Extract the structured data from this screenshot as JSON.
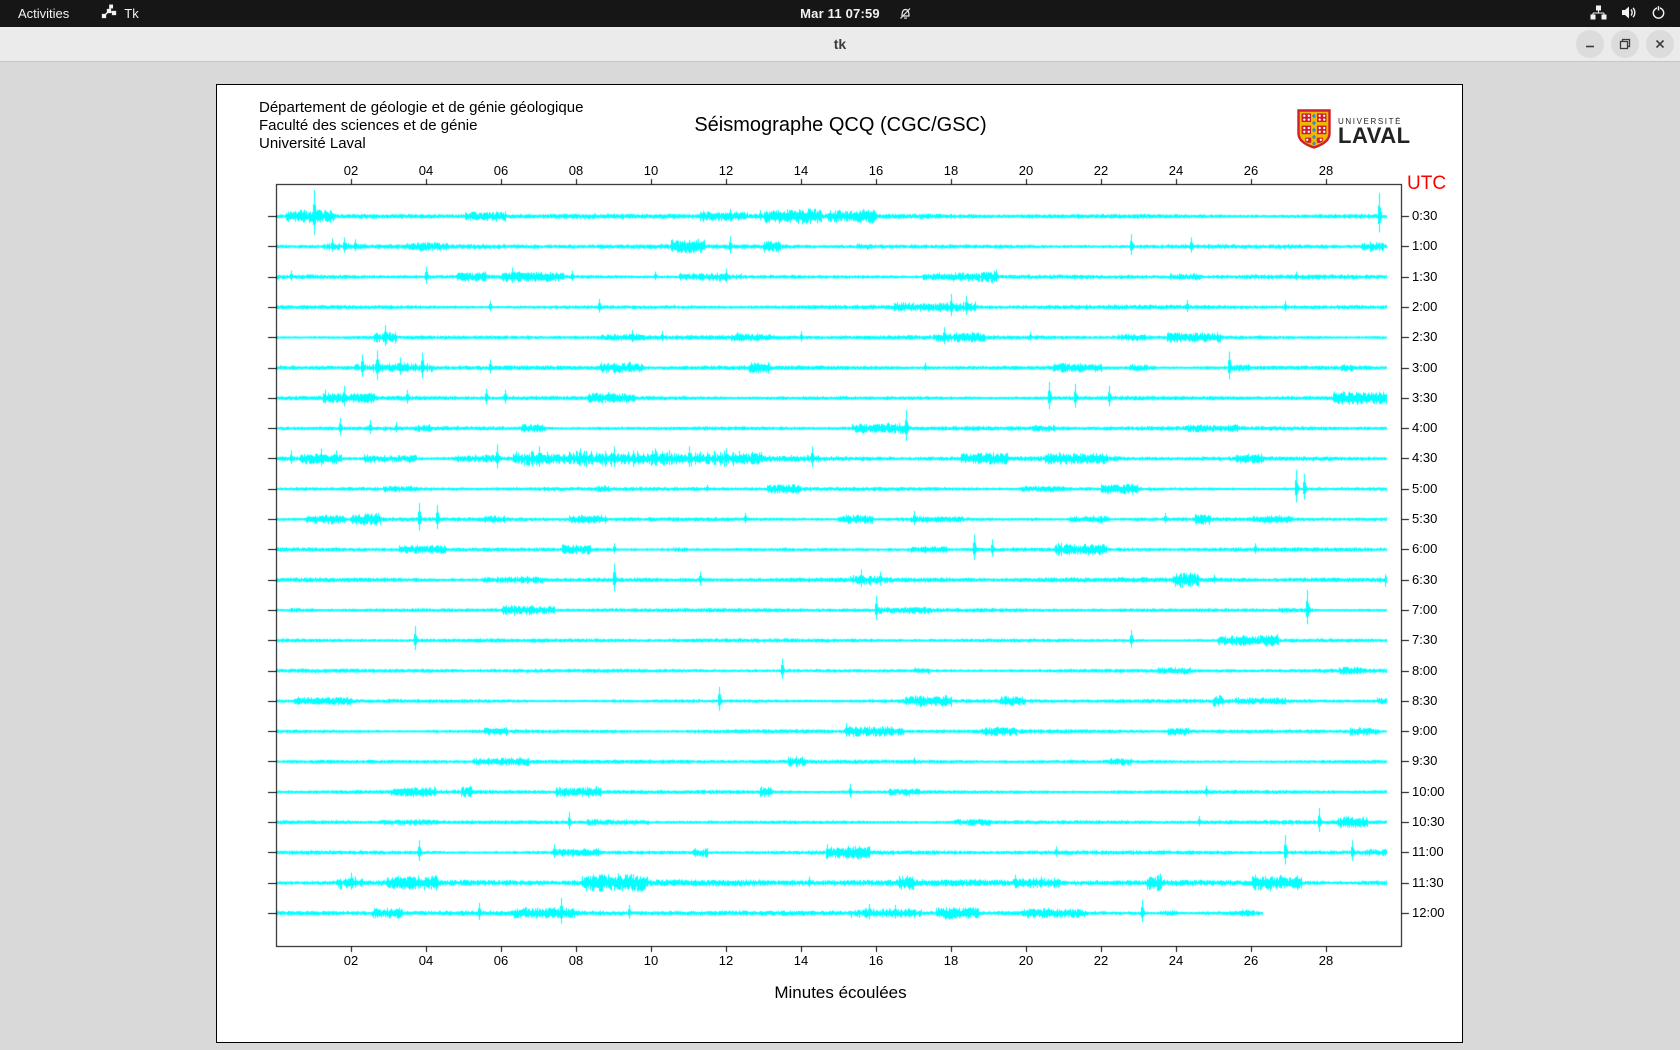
{
  "top_bar": {
    "activities_label": "Activities",
    "app_name": "Tk",
    "clock": "Mar 11 07:59",
    "icons": [
      "tk-app-icon",
      "notifications-disabled-icon",
      "network-wired-icon",
      "volume-icon",
      "power-icon"
    ]
  },
  "title_bar": {
    "title": "tk",
    "buttons": [
      "minimize",
      "restore",
      "close"
    ]
  },
  "figure": {
    "header_lines": [
      "Département de géologie et de génie géologique",
      "Faculté des sciences et de génie",
      "Université Laval"
    ],
    "title": "Séismographe QCQ (CGC/GSC)",
    "logo": {
      "line1": "UNIVERSITÉ",
      "line2": "LAVAL"
    },
    "utc_label": "UTC",
    "xlabel": "Minutes écoulées"
  },
  "colors": {
    "trace": "#00ffff",
    "axis": "#000000",
    "utc_label": "#ff0000",
    "logo_red": "#cf1f2f",
    "logo_gold": "#f2b705",
    "logo_blue": "#2b8fd0"
  },
  "chart_data": {
    "type": "line",
    "subtype": "helicorder-seismogram",
    "title": "Séismographe QCQ (CGC/GSC)",
    "xlabel": "Minutes écoulées",
    "x_range_minutes": [
      0,
      30
    ],
    "x_ticks": [
      "02",
      "04",
      "06",
      "08",
      "10",
      "12",
      "14",
      "16",
      "18",
      "20",
      "22",
      "24",
      "26",
      "28"
    ],
    "y_axis_side": "right",
    "y_unit": "UTC",
    "grid": false,
    "rows": [
      {
        "label": "0:30",
        "noise": 1.3,
        "end": 29.6,
        "spikes": [
          [
            1.0,
            26
          ],
          [
            12.1,
            7
          ],
          [
            12.9,
            6
          ],
          [
            29.4,
            23
          ]
        ],
        "bursts": [
          [
            11.5,
            13.5,
            3
          ]
        ]
      },
      {
        "label": "1:00",
        "noise": 1.2,
        "end": 29.6,
        "spikes": [
          [
            1.5,
            8
          ],
          [
            1.8,
            9
          ],
          [
            2.1,
            7
          ],
          [
            12.1,
            10
          ],
          [
            22.8,
            12
          ],
          [
            24.4,
            9
          ]
        ],
        "bursts": [
          [
            1.2,
            2.4,
            4
          ]
        ]
      },
      {
        "label": "1:30",
        "noise": 1.1,
        "end": 29.6,
        "spikes": [
          [
            0.4,
            6
          ],
          [
            4.0,
            10
          ],
          [
            6.3,
            9
          ],
          [
            7.9,
            6
          ],
          [
            10.1,
            5
          ],
          [
            12.0,
            8
          ],
          [
            19.2,
            7
          ],
          [
            27.2,
            5
          ]
        ],
        "bursts": [
          [
            11.7,
            12.4,
            4
          ]
        ]
      },
      {
        "label": "2:00",
        "noise": 1.1,
        "end": 29.6,
        "spikes": [
          [
            5.7,
            6
          ],
          [
            8.6,
            8
          ],
          [
            18.0,
            13
          ],
          [
            18.4,
            11
          ],
          [
            24.3,
            7
          ],
          [
            26.9,
            6
          ]
        ],
        "bursts": [
          [
            17.7,
            18.7,
            5
          ]
        ]
      },
      {
        "label": "2:30",
        "noise": 1.1,
        "end": 29.6,
        "spikes": [
          [
            2.9,
            12
          ],
          [
            9.5,
            7
          ],
          [
            10.3,
            6
          ],
          [
            12.3,
            5
          ],
          [
            14.0,
            6
          ],
          [
            17.8,
            10
          ],
          [
            20.1,
            5
          ]
        ],
        "bursts": [
          [
            2.6,
            3.2,
            6
          ],
          [
            17.5,
            18.2,
            5
          ]
        ]
      },
      {
        "label": "3:00",
        "noise": 1.1,
        "end": 29.6,
        "spikes": [
          [
            2.3,
            13
          ],
          [
            2.7,
            17
          ],
          [
            3.3,
            10
          ],
          [
            3.9,
            15
          ],
          [
            5.7,
            8
          ],
          [
            9.4,
            6
          ],
          [
            17.3,
            5
          ],
          [
            25.4,
            16
          ]
        ],
        "bursts": [
          [
            2.1,
            4.2,
            5
          ]
        ]
      },
      {
        "label": "3:30",
        "noise": 1.1,
        "end": 29.6,
        "spikes": [
          [
            1.3,
            8
          ],
          [
            1.8,
            12
          ],
          [
            3.5,
            8
          ],
          [
            5.6,
            9
          ],
          [
            6.1,
            8
          ],
          [
            20.6,
            16
          ],
          [
            21.3,
            14
          ],
          [
            22.2,
            12
          ]
        ],
        "bursts": []
      },
      {
        "label": "4:00",
        "noise": 1.1,
        "end": 29.6,
        "spikes": [
          [
            1.7,
            10
          ],
          [
            2.5,
            8
          ],
          [
            3.2,
            6
          ],
          [
            16.8,
            18
          ]
        ],
        "bursts": []
      },
      {
        "label": "4:30",
        "noise": 1.2,
        "end": 29.6,
        "spikes": [
          [
            0.4,
            8
          ],
          [
            1.2,
            10
          ],
          [
            1.6,
            8
          ],
          [
            5.9,
            14
          ],
          [
            7.0,
            12
          ],
          [
            8.1,
            10
          ],
          [
            9.0,
            12
          ],
          [
            10.1,
            10
          ],
          [
            11.0,
            12
          ],
          [
            12.0,
            10
          ],
          [
            14.3,
            12
          ]
        ],
        "bursts": [
          [
            6.3,
            13.0,
            8
          ],
          [
            13.0,
            14.5,
            4
          ]
        ]
      },
      {
        "label": "5:00",
        "noise": 1.0,
        "end": 29.6,
        "spikes": [
          [
            11.5,
            4
          ],
          [
            27.2,
            19
          ],
          [
            27.4,
            15
          ]
        ],
        "bursts": []
      },
      {
        "label": "5:30",
        "noise": 1.0,
        "end": 29.6,
        "spikes": [
          [
            3.8,
            16
          ],
          [
            4.3,
            14
          ],
          [
            12.5,
            6
          ],
          [
            17.0,
            8
          ],
          [
            23.7,
            6
          ]
        ],
        "bursts": []
      },
      {
        "label": "6:00",
        "noise": 1.0,
        "end": 29.6,
        "spikes": [
          [
            9.0,
            6
          ],
          [
            18.6,
            15
          ],
          [
            19.1,
            10
          ],
          [
            26.1,
            6
          ]
        ],
        "bursts": []
      },
      {
        "label": "6:30",
        "noise": 1.2,
        "end": 29.6,
        "spikes": [
          [
            9.0,
            16
          ],
          [
            11.3,
            8
          ],
          [
            15.6,
            10
          ],
          [
            16.1,
            8
          ],
          [
            25.0,
            5
          ]
        ],
        "bursts": [
          [
            15.3,
            16.4,
            5
          ]
        ]
      },
      {
        "label": "7:00",
        "noise": 1.0,
        "end": 29.6,
        "spikes": [
          [
            16.0,
            14
          ],
          [
            27.5,
            20
          ]
        ],
        "bursts": []
      },
      {
        "label": "7:30",
        "noise": 1.0,
        "end": 29.6,
        "spikes": [
          [
            3.7,
            14
          ],
          [
            22.8,
            10
          ]
        ],
        "bursts": []
      },
      {
        "label": "8:00",
        "noise": 1.0,
        "end": 29.6,
        "spikes": [
          [
            13.5,
            12
          ]
        ],
        "bursts": []
      },
      {
        "label": "8:30",
        "noise": 1.0,
        "end": 29.6,
        "spikes": [
          [
            11.8,
            14
          ]
        ],
        "bursts": []
      },
      {
        "label": "9:00",
        "noise": 1.0,
        "end": 29.6,
        "spikes": [
          [
            15.2,
            8
          ]
        ],
        "bursts": []
      },
      {
        "label": "9:30",
        "noise": 1.0,
        "end": 29.6,
        "spikes": [
          [
            17.0,
            4
          ]
        ],
        "bursts": []
      },
      {
        "label": "10:00",
        "noise": 1.0,
        "end": 29.6,
        "spikes": [
          [
            15.3,
            8
          ],
          [
            24.8,
            6
          ]
        ],
        "bursts": []
      },
      {
        "label": "10:30",
        "noise": 1.0,
        "end": 29.6,
        "spikes": [
          [
            7.8,
            10
          ],
          [
            24.6,
            6
          ],
          [
            27.8,
            14
          ]
        ],
        "bursts": []
      },
      {
        "label": "11:00",
        "noise": 1.1,
        "end": 29.6,
        "spikes": [
          [
            3.8,
            12
          ],
          [
            7.4,
            8
          ],
          [
            14.7,
            8
          ],
          [
            15.8,
            6
          ],
          [
            20.8,
            6
          ],
          [
            26.9,
            17
          ],
          [
            28.7,
            12
          ]
        ],
        "bursts": []
      },
      {
        "label": "11:30",
        "noise": 1.7,
        "end": 29.6,
        "spikes": [
          [
            2.0,
            10
          ],
          [
            9.9,
            6
          ],
          [
            14.2,
            6
          ],
          [
            19.7,
            8
          ],
          [
            20.4,
            6
          ]
        ],
        "bursts": [
          [
            1.6,
            2.3,
            6
          ]
        ]
      },
      {
        "label": "12:00",
        "noise": 1.3,
        "end": 26.3,
        "spikes": [
          [
            5.4,
            10
          ],
          [
            7.6,
            15
          ],
          [
            9.4,
            8
          ],
          [
            15.8,
            9
          ],
          [
            16.5,
            8
          ],
          [
            23.1,
            13
          ]
        ],
        "bursts": [
          [
            15.3,
            17.2,
            5
          ]
        ]
      }
    ]
  }
}
